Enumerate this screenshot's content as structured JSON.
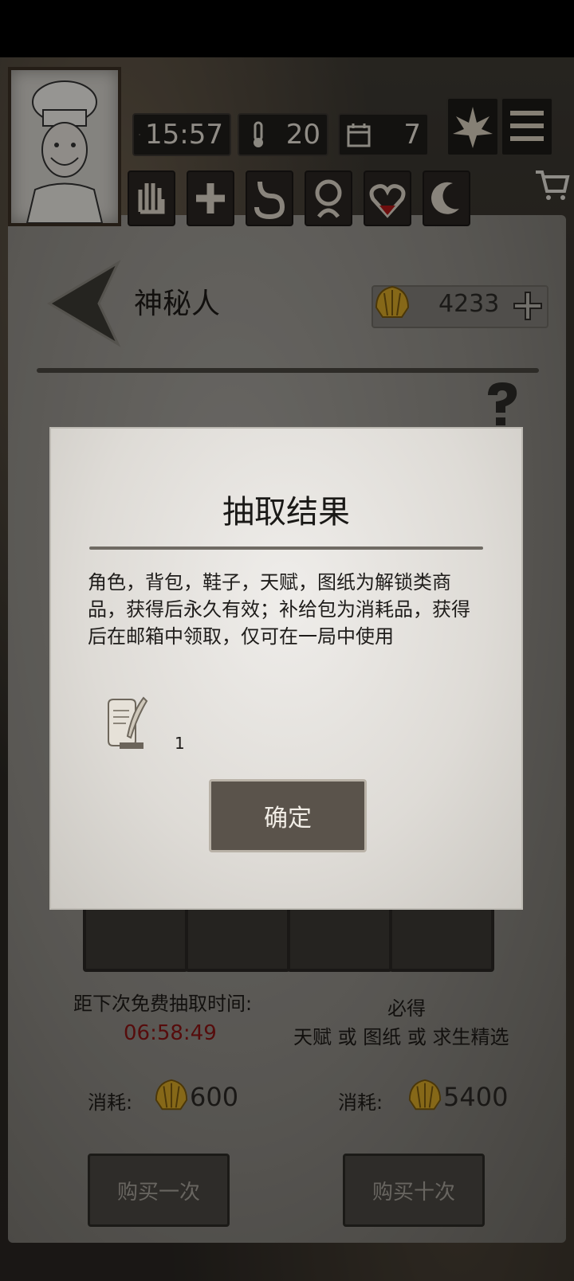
{
  "status_bar": {
    "time": "15:57",
    "temperature": "20",
    "day": "7"
  },
  "header": {
    "title": "神秘人",
    "currency_amount": "4233"
  },
  "draw_info": {
    "free_timer_label": "距下次免费抽取时间:",
    "free_timer_value": "06:58:49",
    "guarantee_title": "必得",
    "guarantee_desc": "天赋 或 图纸 或 求生精选"
  },
  "single_draw": {
    "cost_label": "消耗:",
    "cost_value": "600",
    "button_label": "购买一次"
  },
  "ten_draw": {
    "cost_label": "消耗:",
    "cost_value": "5400",
    "button_label": "购买十次"
  },
  "modal": {
    "title": "抽取结果",
    "description_lines": [
      "角色，背包，鞋子，天赋，图纸为解锁类商",
      "品，获得后永久有效；补给包为消耗品，获得",
      "后在邮箱中领取，仅可在一局中使用"
    ],
    "item": {
      "icon": "scroll-quill-icon",
      "quantity": "1"
    },
    "confirm_label": "确定"
  },
  "icons": [
    "clock-icon",
    "thermometer-icon",
    "calendar-icon",
    "leaf-icon",
    "menu-icon",
    "cart-icon",
    "hand-icon",
    "plus-icon",
    "stomach-icon",
    "head-icon",
    "heart-icon",
    "moon-icon",
    "back-arrow-icon",
    "shell-coin-icon",
    "add-icon",
    "help-icon"
  ],
  "colors": {
    "timer": "#8c1414",
    "paper": "#a9a6a0",
    "modal": "#efedea",
    "button": "#5a534b"
  }
}
